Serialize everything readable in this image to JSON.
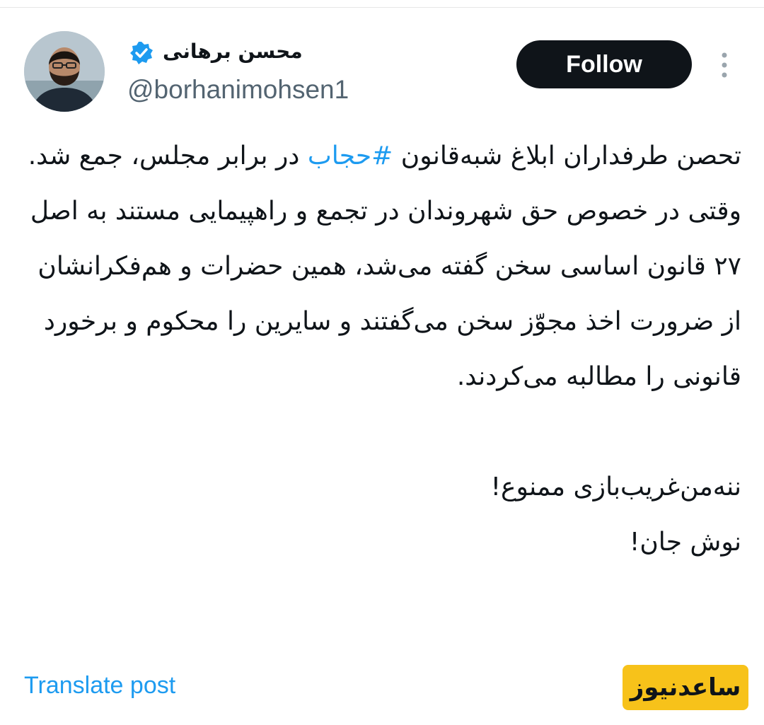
{
  "tweet": {
    "author": {
      "name": "محسن برهانی",
      "handle": "@borhanimohsen1",
      "verified": true,
      "avatar_icon": "profile-photo"
    },
    "follow_label": "Follow",
    "more_icon": "more-vertical-icon",
    "body": {
      "line1_before": "تحصن طرفداران ابلاغ شبه‌قانون ",
      "hashtag": "#حجاب",
      "line1_after": " در برابر مجلس، جمع شد.",
      "para2": "وقتی در خصوص حق شهروندان در تجمع و راهپیمایی مستند به اصل ۲۷ قانون اساسی سخن گفته می‌شد، همین حضرات و هم‌فکرانشان از ضرورت اخذ مجوّز سخن می‌گفتند و سایرین را محکوم و برخورد قانونی را مطالبه می‌کردند.",
      "line3": "ننه‌من‌غریب‌بازی ممنوع!",
      "line4": "نوش جان!"
    },
    "translate_label": "Translate post"
  },
  "watermark": {
    "text": "ساعدنیوز"
  },
  "colors": {
    "link": "#1d9bf0",
    "text": "#0f1419",
    "secondary": "#536471",
    "verified": "#1d9bf0",
    "watermark_bg": "#f7c21a"
  }
}
